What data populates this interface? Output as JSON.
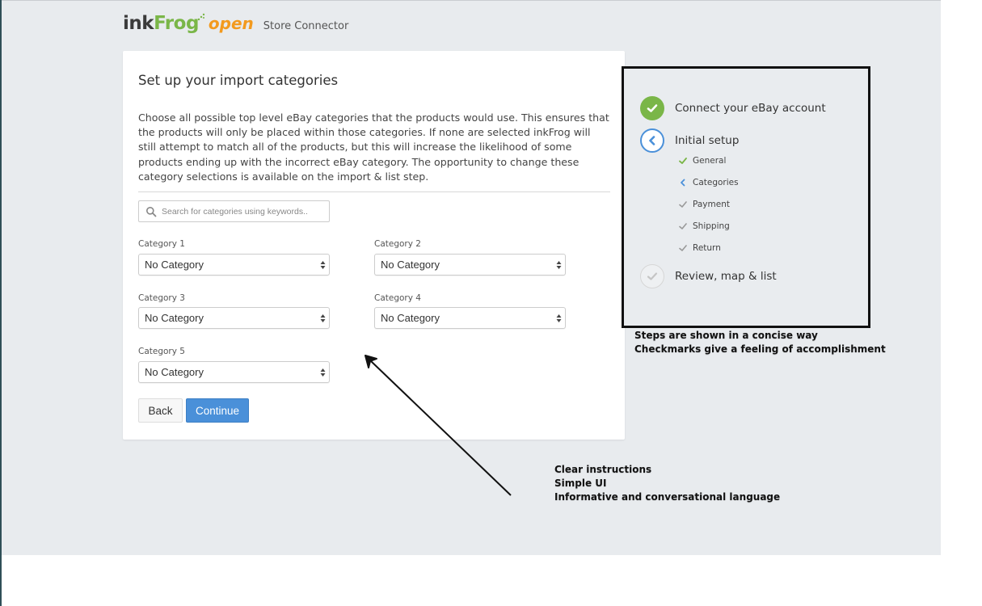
{
  "header": {
    "logo_part1": "ink",
    "logo_part2": "Frog",
    "logo_part3": "open",
    "subtitle": "Store Connector"
  },
  "card": {
    "title": "Set up your import categories",
    "description": "Choose all possible top level eBay categories that the products would use. This ensures that the products will only be placed within those categories. If none are selected inkFrog will still attempt to match all of the products, but this will increase the likelihood of some products ending up with the incorrect eBay category. The opportunity to change these category selections is available on the import & list step.",
    "search": {
      "placeholder": "Search for categories using keywords..",
      "value": ""
    },
    "categories": [
      {
        "label": "Category 1",
        "value": "No Category"
      },
      {
        "label": "Category 2",
        "value": "No Category"
      },
      {
        "label": "Category 3",
        "value": "No Category"
      },
      {
        "label": "Category 4",
        "value": "No Category"
      },
      {
        "label": "Category 5",
        "value": "No Category"
      }
    ],
    "back_label": "Back",
    "continue_label": "Continue"
  },
  "steps": {
    "main": [
      {
        "label": "Connect your eBay account",
        "state": "complete"
      },
      {
        "label": "Initial setup",
        "state": "current"
      },
      {
        "label": "Review, map & list",
        "state": "pending"
      }
    ],
    "sub": [
      {
        "label": "General",
        "state": "complete"
      },
      {
        "label": "Categories",
        "state": "current"
      },
      {
        "label": "Payment",
        "state": "pending"
      },
      {
        "label": "Shipping",
        "state": "pending"
      },
      {
        "label": "Return",
        "state": "pending"
      }
    ]
  },
  "annotations": {
    "steps_note": [
      "Steps are shown in a concise way",
      "Checkmarks give a feeling of accomplishment"
    ],
    "ui_note": [
      "Clear instructions",
      "Simple UI",
      "Informative and conversational language"
    ]
  },
  "colors": {
    "complete": "#7ab648",
    "current": "#4a90d9",
    "pending": "#999999",
    "primary_button": "#4a90d9",
    "logo_green": "#7ab648",
    "logo_orange": "#f39a1e"
  }
}
